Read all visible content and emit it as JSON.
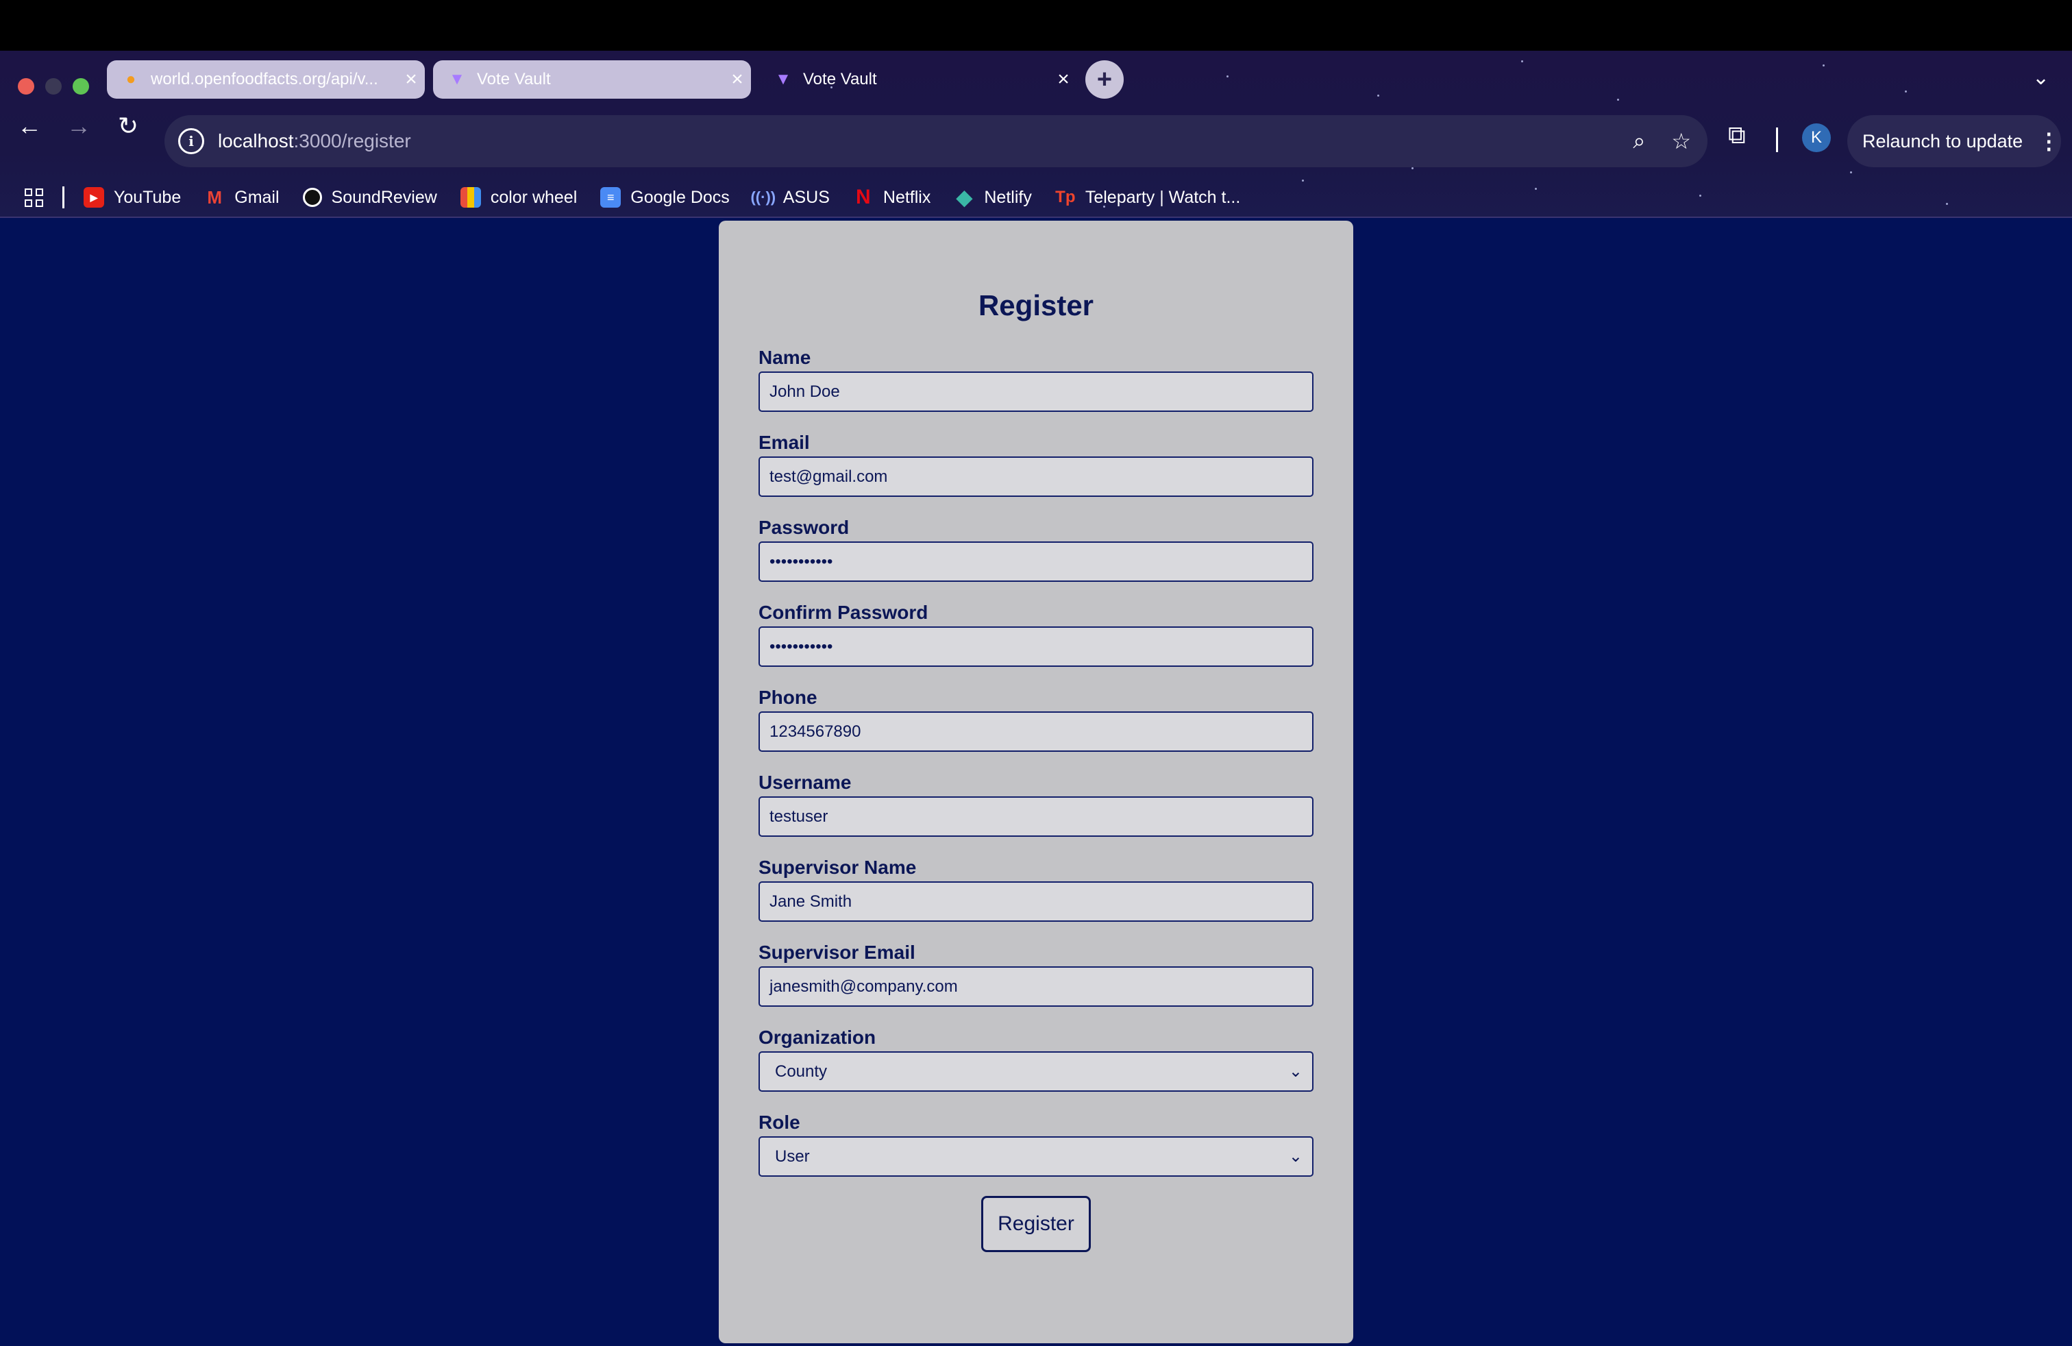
{
  "browser": {
    "tabs": [
      {
        "title": "world.openfoodfacts.org/api/v...",
        "favicon": "openfoodfacts-icon",
        "active": false
      },
      {
        "title": "Vote Vault",
        "favicon": "vite-icon",
        "active": false
      },
      {
        "title": "Vote Vault",
        "favicon": "vite-icon",
        "active": true
      }
    ],
    "new_tab_label": "+",
    "url_host": "localhost",
    "url_path": ":3000/register",
    "profile_initial": "K",
    "relaunch_label": "Relaunch to update",
    "bookmarks": [
      {
        "label": "YouTube",
        "icon": "youtube-icon"
      },
      {
        "label": "Gmail",
        "icon": "gmail-icon"
      },
      {
        "label": "SoundReview",
        "icon": "soundreview-icon"
      },
      {
        "label": "color wheel",
        "icon": "color-wheel-icon"
      },
      {
        "label": "Google Docs",
        "icon": "google-docs-icon"
      },
      {
        "label": "ASUS",
        "icon": "asus-icon"
      },
      {
        "label": "Netflix",
        "icon": "netflix-icon"
      },
      {
        "label": "Netlify",
        "icon": "netlify-icon"
      },
      {
        "label": "Teleparty | Watch t...",
        "icon": "teleparty-icon"
      }
    ]
  },
  "form": {
    "title": "Register",
    "fields": {
      "name": {
        "label": "Name",
        "value": "John Doe"
      },
      "email": {
        "label": "Email",
        "value": "test@gmail.com"
      },
      "password": {
        "label": "Password",
        "value": "•••••••••••"
      },
      "confirm_password": {
        "label": "Confirm Password",
        "value": "•••••••••••"
      },
      "phone": {
        "label": "Phone",
        "value": "1234567890"
      },
      "username": {
        "label": "Username",
        "value": "testuser"
      },
      "supervisor_name": {
        "label": "Supervisor Name",
        "value": "Jane Smith"
      },
      "supervisor_email": {
        "label": "Supervisor Email",
        "value": "janesmith@company.com"
      },
      "organization": {
        "label": "Organization",
        "value": "County"
      },
      "role": {
        "label": "Role",
        "value": "User"
      }
    },
    "submit_label": "Register"
  },
  "colors": {
    "page_bg": "#021158",
    "card_bg": "#c3c3c6",
    "text": "#0b1656",
    "chrome_bg": "#1c1445"
  }
}
